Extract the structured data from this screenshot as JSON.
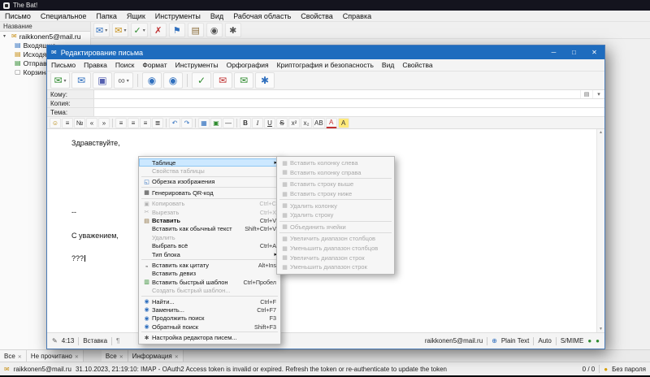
{
  "colors": {
    "accent": "#1e6cbe",
    "highlight": "#cce8ff",
    "highlight_border": "#8fc6f2"
  },
  "icons": {
    "mail": "✉",
    "pencil": "✎",
    "globe": "⊕",
    "green_dot": "●",
    "key_dot": "●",
    "expand": "▾",
    "grid": "▤",
    "dropdown": "▾",
    "scroll_up": "▲",
    "scroll_down": "▼",
    "paragraph": "¶"
  },
  "main_window": {
    "title": "The Bat!",
    "menu": [
      "Письмо",
      "Специальное",
      "Папка",
      "Ящик",
      "Инструменты",
      "Вид",
      "Рабочая область",
      "Свойства",
      "Справка"
    ],
    "toolbar": [
      {
        "name": "create-message-button",
        "glyph": "✉",
        "color": "#2f6fbe",
        "dropdown": true
      },
      {
        "name": "reply-button",
        "glyph": "✉",
        "color": "#c89018",
        "dropdown": true
      },
      {
        "name": "check-mail-button",
        "glyph": "✓",
        "color": "#2e8b2e",
        "dropdown": true
      },
      {
        "name": "delete-button",
        "glyph": "✗",
        "color": "#c03030"
      },
      {
        "name": "flag-button",
        "glyph": "⚑",
        "color": "#2f6fbe"
      },
      {
        "name": "address-book-button",
        "glyph": "▤",
        "color": "#8a6d3b"
      },
      {
        "name": "search-button",
        "glyph": "◉",
        "color": "#555555"
      },
      {
        "name": "settings-button",
        "glyph": "✱",
        "color": "#555555"
      }
    ],
    "tree_header": "Название",
    "account": {
      "label": "raikkonen5@mail.ru",
      "glyph": "✉",
      "color": "#c89018"
    },
    "folders": [
      {
        "label": "Входящие",
        "glyph": "▤",
        "color": "#2f6fbe"
      },
      {
        "label": "Исходящие",
        "glyph": "▤",
        "color": "#c89018"
      },
      {
        "label": "Отправленные",
        "glyph": "▤",
        "color": "#2e8b2e"
      },
      {
        "label": "Корзина",
        "glyph": "▢",
        "color": "#777777"
      }
    ],
    "tabs_left": [
      "Все",
      "Не прочитано"
    ],
    "tabs_right": [
      "Все",
      "Информация"
    ],
    "status": {
      "account": "raikkonen5@mail.ru",
      "message": "31.10.2023, 21:19:10: IMAP - OAuth2 Access token is invalid or expired. Refresh the token or re-authenticate to update the token",
      "counter": "0 / 0",
      "password_label": "Без пароля"
    }
  },
  "compose": {
    "title": "Редактирование письма",
    "window_controls": [
      {
        "name": "minimize-button",
        "glyph": "─"
      },
      {
        "name": "maximize-button",
        "glyph": "□"
      },
      {
        "name": "close-button",
        "glyph": "✕"
      }
    ],
    "menu": [
      "Письмо",
      "Правка",
      "Поиск",
      "Формат",
      "Инструменты",
      "Орфография",
      "Криптография и безопасность",
      "Вид",
      "Свойства"
    ],
    "toolbar": [
      {
        "name": "send-button",
        "glyph": "✉",
        "color": "#2e8b2e",
        "dropdown": true
      },
      {
        "name": "send-later-button",
        "glyph": "✉",
        "color": "#2f6fbe"
      },
      {
        "name": "save-button",
        "glyph": "▣",
        "color": "#5560b0"
      },
      {
        "name": "attach-button",
        "glyph": "∞",
        "color": "#666666",
        "dropdown": true
      },
      {
        "type": "separator"
      },
      {
        "name": "find-button",
        "glyph": "◉",
        "color": "#2f6fbe"
      },
      {
        "name": "find-next-button",
        "glyph": "◉",
        "color": "#2f6fbe"
      },
      {
        "type": "separator"
      },
      {
        "name": "spell-check-button",
        "glyph": "✓",
        "color": "#2e8b2e"
      },
      {
        "name": "encrypt-button",
        "glyph": "✉",
        "color": "#c03030"
      },
      {
        "name": "sign-button",
        "glyph": "✉",
        "color": "#2e8b2e"
      },
      {
        "name": "privacy-button",
        "glyph": "✱",
        "color": "#2f6fbe"
      }
    ],
    "fields": [
      {
        "label": "Кому:",
        "value": ""
      },
      {
        "label": "Копия:",
        "value": ""
      },
      {
        "label": "Тема:",
        "value": ""
      }
    ],
    "format_toolbar": [
      {
        "name": "smiley-button",
        "glyph": "☺",
        "color": "#b08000"
      },
      {
        "name": "bullet-list-button",
        "glyph": "≡"
      },
      {
        "name": "numbered-list-button",
        "glyph": "№"
      },
      {
        "name": "outdent-button",
        "glyph": "«"
      },
      {
        "name": "indent-button",
        "glyph": "»"
      },
      {
        "type": "separator"
      },
      {
        "name": "align-left-button",
        "glyph": "≡"
      },
      {
        "name": "align-center-button",
        "glyph": "≡"
      },
      {
        "name": "align-right-button",
        "glyph": "≡"
      },
      {
        "name": "justify-button",
        "glyph": "≣"
      },
      {
        "type": "separator"
      },
      {
        "name": "undo-button",
        "glyph": "↶",
        "color": "#2f6fbe"
      },
      {
        "name": "redo-button",
        "glyph": "↷",
        "color": "#2f6fbe"
      },
      {
        "type": "separator"
      },
      {
        "name": "insert-table-button",
        "glyph": "▦",
        "color": "#2f6fbe"
      },
      {
        "name": "insert-image-button",
        "glyph": "▣",
        "color": "#2e8b2e"
      },
      {
        "name": "insert-rule-button",
        "glyph": "—"
      },
      {
        "type": "separator"
      },
      {
        "name": "bold-button",
        "glyph": "B"
      },
      {
        "name": "italic-button",
        "glyph": "I"
      },
      {
        "name": "underline-button",
        "glyph": "U"
      },
      {
        "name": "strike-button",
        "glyph": "S"
      },
      {
        "name": "superscript-button",
        "glyph": "x²"
      },
      {
        "name": "subscript-button",
        "glyph": "x₂"
      },
      {
        "name": "font-button",
        "glyph": "AB"
      },
      {
        "name": "font-color-button",
        "glyph": "A",
        "color": "#c03030"
      },
      {
        "name": "highlight-button",
        "glyph": "A"
      }
    ],
    "editor_lines": [
      {
        "text": "Здравствуйте,"
      },
      {
        "text": ""
      },
      {
        "text": ""
      },
      {
        "text": "--"
      },
      {
        "text": "С уважением,"
      },
      {
        "text": "???",
        "caret": true
      }
    ],
    "status": {
      "position": "4:13",
      "mode": "Вставка",
      "account": "raikkonen5@mail.ru",
      "format": "Plain Text",
      "charset": "Auto",
      "security": "S/MIME"
    }
  },
  "context_menu": {
    "items": [
      {
        "name": "menu-item-table",
        "label": "Таблице",
        "submenu": true,
        "highlighted": true
      },
      {
        "name": "menu-item-table-properties",
        "label": "Свойства таблицы",
        "enabled": false
      },
      {
        "type": "separator"
      },
      {
        "name": "menu-item-crop-image",
        "label": "Обрезка изображения",
        "glyph": "◱",
        "color": "#2f6fbe"
      },
      {
        "type": "separator"
      },
      {
        "name": "menu-item-generate-qr",
        "label": "Генерировать QR-код",
        "glyph": "▦",
        "color": "#333333"
      },
      {
        "type": "separator"
      },
      {
        "name": "menu-item-copy",
        "label": "Копировать",
        "shortcut": "Ctrl+C",
        "enabled": false,
        "glyph": "▣"
      },
      {
        "name": "menu-item-cut",
        "label": "Вырезать",
        "shortcut": "Ctrl+X",
        "enabled": false,
        "glyph": "✂"
      },
      {
        "name": "menu-item-paste",
        "label": "Вставить",
        "shortcut": "Ctrl+V",
        "bold": true,
        "glyph": "▤",
        "color": "#8a6d3b"
      },
      {
        "name": "menu-item-paste-plain",
        "label": "Вставить как обычный текст",
        "shortcut": "Shift+Ctrl+V"
      },
      {
        "name": "menu-item-delete",
        "label": "Удалить",
        "enabled": false
      },
      {
        "name": "menu-item-select-all",
        "label": "Выбрать всё",
        "shortcut": "Ctrl+A"
      },
      {
        "name": "menu-item-block-type",
        "label": "Тип блока",
        "submenu": true
      },
      {
        "type": "separator"
      },
      {
        "name": "menu-item-paste-as-quote",
        "label": "Вставить как цитату",
        "shortcut": "Alt+Ins",
        "glyph": "„"
      },
      {
        "name": "menu-item-insert-motto",
        "label": "Вставить девиз"
      },
      {
        "name": "menu-item-insert-quick-template",
        "label": "Вставить быстрый шаблон",
        "shortcut": "Ctrl+Пробел",
        "glyph": "▥",
        "color": "#2e8b2e"
      },
      {
        "name": "menu-item-create-quick-template",
        "label": "Создать быстрый шаблон...",
        "enabled": false
      },
      {
        "type": "separator"
      },
      {
        "name": "menu-item-find",
        "label": "Найти...",
        "shortcut": "Ctrl+F",
        "glyph": "◉",
        "color": "#2f6fbe"
      },
      {
        "name": "menu-item-replace",
        "label": "Заменить...",
        "shortcut": "Ctrl+F7",
        "glyph": "◉",
        "color": "#2f6fbe"
      },
      {
        "name": "menu-item-find-next",
        "label": "Продолжить поиск",
        "shortcut": "F3",
        "glyph": "◉",
        "color": "#2f6fbe"
      },
      {
        "name": "menu-item-find-prev",
        "label": "Обратный поиск",
        "shortcut": "Shift+F3",
        "glyph": "◉",
        "color": "#2f6fbe"
      },
      {
        "type": "separator"
      },
      {
        "name": "menu-item-editor-settings",
        "label": "Настройка редактора писем...",
        "glyph": "✱",
        "color": "#555555"
      }
    ]
  },
  "table_submenu": {
    "items": [
      {
        "name": "menu-item-insert-column-left",
        "label": "Вставить колонку слева",
        "enabled": false,
        "glyph": "▦"
      },
      {
        "name": "menu-item-insert-column-right",
        "label": "Вставить колонку справа",
        "enabled": false,
        "glyph": "▦"
      },
      {
        "type": "separator"
      },
      {
        "name": "menu-item-insert-row-above",
        "label": "Вставить строку выше",
        "enabled": false,
        "glyph": "▦"
      },
      {
        "name": "menu-item-insert-row-below",
        "label": "Вставить строку ниже",
        "enabled": false,
        "glyph": "▦"
      },
      {
        "type": "separator"
      },
      {
        "name": "menu-item-delete-column",
        "label": "Удалить колонку",
        "enabled": false,
        "glyph": "▦"
      },
      {
        "name": "menu-item-delete-row",
        "label": "Удалить строку",
        "enabled": false,
        "glyph": "▦"
      },
      {
        "type": "separator"
      },
      {
        "name": "menu-item-merge-cells",
        "label": "Объединить ячейки",
        "enabled": false,
        "glyph": "▦"
      },
      {
        "type": "separator"
      },
      {
        "name": "menu-item-increase-column-span",
        "label": "Увеличить диапазон столбцов",
        "enabled": false,
        "glyph": "▦"
      },
      {
        "name": "menu-item-decrease-column-span",
        "label": "Уменьшить диапазон столбцов",
        "enabled": false,
        "glyph": "▦"
      },
      {
        "name": "menu-item-increase-row-span",
        "label": "Увеличить диапазон строк",
        "enabled": false,
        "glyph": "▦"
      },
      {
        "name": "menu-item-decrease-row-span",
        "label": "Уменьшить диапазон строк",
        "enabled": false,
        "glyph": "▦"
      }
    ]
  }
}
